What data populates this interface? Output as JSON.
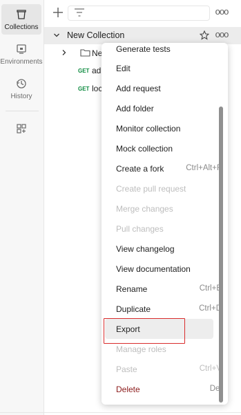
{
  "rail": {
    "items": [
      {
        "label": "Collections",
        "icon": "collections-icon",
        "active": true
      },
      {
        "label": "Environments",
        "icon": "environments-icon",
        "active": false
      },
      {
        "label": "History",
        "icon": "history-icon",
        "active": false
      }
    ],
    "apps_icon": "apps-add-icon"
  },
  "topbar": {
    "new_icon": "plus-icon",
    "filter_icon": "filter-icon",
    "more_icon": "more-icon",
    "more_label": "ooo"
  },
  "collection": {
    "name": "New Collection",
    "star_icon": "star-icon",
    "more_label": "ooo",
    "folder_name": "Ne",
    "requests": [
      {
        "method": "GET",
        "name": "ad"
      },
      {
        "method": "GET",
        "name": "loc"
      }
    ]
  },
  "menu": {
    "items": [
      {
        "label": "Generate tests",
        "shortcut": "",
        "state": "normal"
      },
      {
        "label": "Edit",
        "shortcut": "",
        "state": "normal"
      },
      {
        "label": "Add request",
        "shortcut": "",
        "state": "normal"
      },
      {
        "label": "Add folder",
        "shortcut": "",
        "state": "normal"
      },
      {
        "label": "Monitor collection",
        "shortcut": "",
        "state": "normal"
      },
      {
        "label": "Mock collection",
        "shortcut": "",
        "state": "normal"
      },
      {
        "label": "Create a fork",
        "shortcut": "Ctrl+Alt+F",
        "state": "normal"
      },
      {
        "label": "Create pull request",
        "shortcut": "",
        "state": "disabled"
      },
      {
        "label": "Merge changes",
        "shortcut": "",
        "state": "disabled"
      },
      {
        "label": "Pull changes",
        "shortcut": "",
        "state": "disabled"
      },
      {
        "label": "View changelog",
        "shortcut": "",
        "state": "normal"
      },
      {
        "label": "View documentation",
        "shortcut": "",
        "state": "normal"
      },
      {
        "label": "Rename",
        "shortcut": "Ctrl+E",
        "state": "normal"
      },
      {
        "label": "Duplicate",
        "shortcut": "Ctrl+D",
        "state": "normal"
      },
      {
        "label": "Export",
        "shortcut": "",
        "state": "hover"
      },
      {
        "label": "Manage roles",
        "shortcut": "",
        "state": "disabled"
      },
      {
        "label": "Paste",
        "shortcut": "Ctrl+V",
        "state": "disabled"
      },
      {
        "label": "Delete",
        "shortcut": "Del",
        "state": "danger"
      }
    ],
    "highlight_color": "#d92b2b"
  },
  "colors": {
    "get_method": "#0c8a3f",
    "delete_text": "#8b1a1a"
  }
}
